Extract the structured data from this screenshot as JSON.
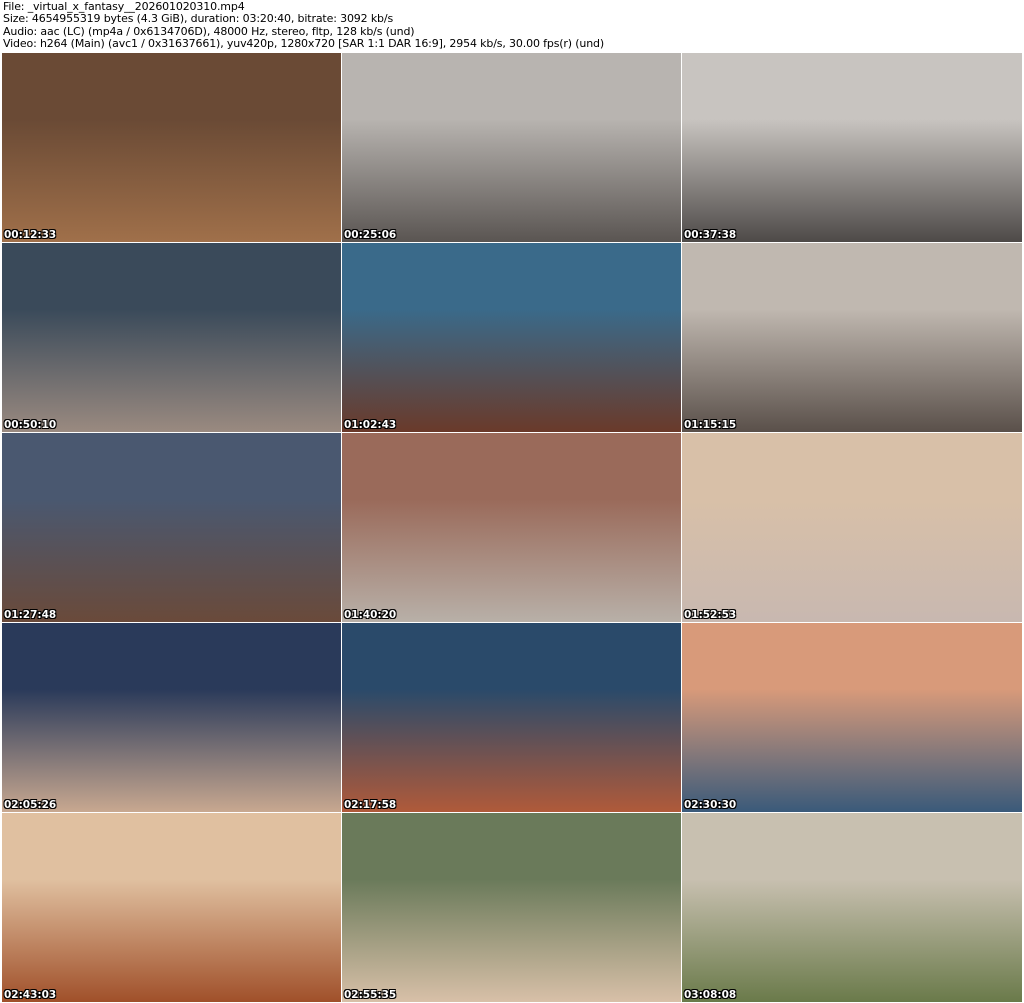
{
  "header": {
    "file": "File: _virtual_x_fantasy__202601020310.mp4",
    "size": "Size: 4654955319 bytes (4.3 GiB), duration: 03:20:40, bitrate: 3092 kb/s",
    "audio": "Audio: aac (LC) (mp4a / 0x6134706D), 48000 Hz, stereo, fltp, 128 kb/s (und)",
    "video": "Video: h264 (Main) (avc1 / 0x31637661), yuv420p, 1280x720 [SAR 1:1 DAR 16:9], 2954 kb/s, 30.00 fps(r) (und)"
  },
  "thumbnails": [
    {
      "timestamp": "00:12:33",
      "colors": [
        "#6a4a35",
        "#a0704a"
      ]
    },
    {
      "timestamp": "00:25:06",
      "colors": [
        "#b8b4b0",
        "#5a5552"
      ]
    },
    {
      "timestamp": "00:37:38",
      "colors": [
        "#c8c4c0",
        "#4e4a48"
      ]
    },
    {
      "timestamp": "00:50:10",
      "colors": [
        "#3a4a5a",
        "#9a8a80"
      ]
    },
    {
      "timestamp": "01:02:43",
      "colors": [
        "#3a6a8a",
        "#6a3a2a"
      ]
    },
    {
      "timestamp": "01:15:15",
      "colors": [
        "#c0b8b0",
        "#5a504a"
      ]
    },
    {
      "timestamp": "01:27:48",
      "colors": [
        "#4a5870",
        "#6a4a3a"
      ]
    },
    {
      "timestamp": "01:40:20",
      "colors": [
        "#9a6a5a",
        "#b8b0a8"
      ]
    },
    {
      "timestamp": "01:52:53",
      "colors": [
        "#d8c0a8",
        "#c8b8b0"
      ]
    },
    {
      "timestamp": "02:05:26",
      "colors": [
        "#2a3a5a",
        "#c8a890"
      ]
    },
    {
      "timestamp": "02:17:58",
      "colors": [
        "#2a4a6a",
        "#b05a3a"
      ]
    },
    {
      "timestamp": "02:30:30",
      "colors": [
        "#d89a7a",
        "#3a5a7a"
      ]
    },
    {
      "timestamp": "02:43:03",
      "colors": [
        "#e0c0a0",
        "#a0502a"
      ]
    },
    {
      "timestamp": "02:55:35",
      "colors": [
        "#6a7a5a",
        "#d8c0a8"
      ]
    },
    {
      "timestamp": "03:08:08",
      "colors": [
        "#c8c0b0",
        "#6a7a4a"
      ]
    }
  ]
}
